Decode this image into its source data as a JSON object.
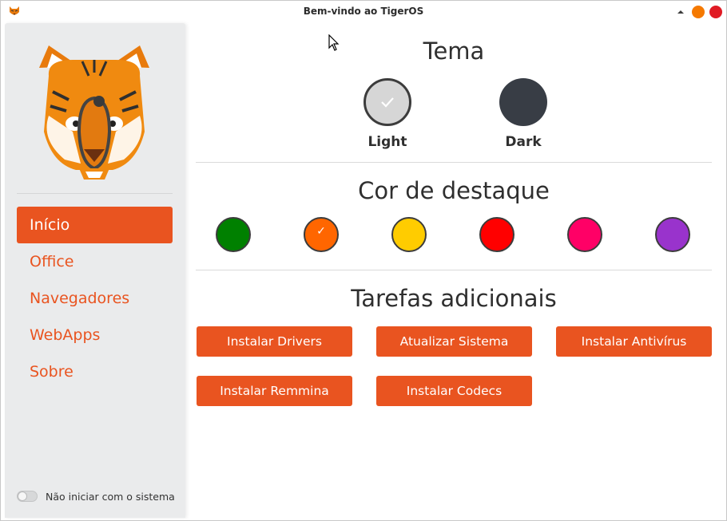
{
  "window": {
    "title": "Bem-vindo ao TigerOS",
    "icons": {
      "app": "tiger-icon",
      "collapse": "chevron-up-icon",
      "minimize": "minimize-icon",
      "close": "close-icon"
    },
    "colors": {
      "minimize": "#f57900",
      "close": "#e01b24"
    }
  },
  "sidebar": {
    "logo_icon": "tiger-logo-icon",
    "items": [
      {
        "label": "Início",
        "active": true
      },
      {
        "label": "Office",
        "active": false
      },
      {
        "label": "Navegadores",
        "active": false
      },
      {
        "label": "WebApps",
        "active": false
      },
      {
        "label": "Sobre",
        "active": false
      }
    ],
    "startup_toggle": {
      "label": "Não iniciar com o sistema",
      "checked": false
    }
  },
  "theme": {
    "heading": "Tema",
    "options": [
      {
        "label": "Light",
        "color": "#d6d6d6",
        "selected": true
      },
      {
        "label": "Dark",
        "color": "#383d45",
        "selected": false
      }
    ]
  },
  "accent": {
    "heading": "Cor de destaque",
    "colors": [
      {
        "name": "green",
        "hex": "#008000",
        "selected": false
      },
      {
        "name": "orange",
        "hex": "#ff6600",
        "selected": true
      },
      {
        "name": "yellow",
        "hex": "#ffcc00",
        "selected": false
      },
      {
        "name": "red",
        "hex": "#ff0000",
        "selected": false
      },
      {
        "name": "pink",
        "hex": "#ff0066",
        "selected": false
      },
      {
        "name": "purple",
        "hex": "#9933cc",
        "selected": false
      }
    ]
  },
  "tasks": {
    "heading": "Tarefas adicionais",
    "buttons": [
      {
        "label": "Instalar Drivers"
      },
      {
        "label": "Atualizar Sistema"
      },
      {
        "label": "Instalar Antivírus"
      },
      {
        "label": "Instalar Remmina"
      },
      {
        "label": "Instalar Codecs"
      }
    ]
  },
  "colors": {
    "accent": "#e95420",
    "sidebar_bg": "#eaebec"
  }
}
